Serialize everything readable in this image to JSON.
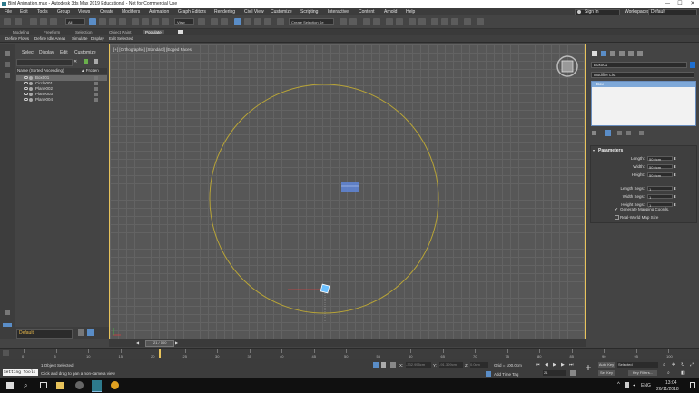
{
  "window": {
    "title": "Bird Animation.max - Autodesk 3ds Max 2019 Educational - Not for Commercial Use",
    "minimize": "—",
    "maximize": "☐",
    "close": "✕"
  },
  "menu": {
    "items": [
      "File",
      "Edit",
      "Tools",
      "Group",
      "Views",
      "Create",
      "Modifiers",
      "Animation",
      "Graph Editors",
      "Rendering",
      "Civil View",
      "Customize",
      "Scripting",
      "Interactive",
      "Content",
      "Arnold",
      "Help"
    ],
    "sign_in": "Sign In",
    "workspaces_label": "Workspaces:",
    "workspaces_value": "Default"
  },
  "toolbar": {
    "filter_value": "All",
    "view_value": "View",
    "selection_set_placeholder": "Create Selection Se",
    "snap_label": "3",
    "angle_label": "%"
  },
  "ribbon": {
    "tabs": [
      "Modeling",
      "Freeform",
      "Selection",
      "Object Paint",
      "Populate"
    ],
    "active_tab": "Populate",
    "subtabs": [
      "Define Flows",
      "Define Idle Areas",
      "Simulate",
      "Display",
      "Edit Selected"
    ]
  },
  "explorer": {
    "tabs": [
      "Select",
      "Display",
      "Edit",
      "Customize"
    ],
    "column_name": "Name (Sorted Ascending)",
    "column_frozen": "▲ Frozen",
    "rows": [
      {
        "name": "Box001",
        "selected": true
      },
      {
        "name": "Circle001",
        "selected": false
      },
      {
        "name": "Plane002",
        "selected": false
      },
      {
        "name": "Plane003",
        "selected": false
      },
      {
        "name": "Plane004",
        "selected": false
      }
    ]
  },
  "viewport": {
    "label": "[+] [Orthographic] [Standard] [Edged Faces]"
  },
  "command_panel": {
    "object_name": "Box001",
    "modifier_list": "Modifier List",
    "stack_item": "Box",
    "rollout_title": "Parameters",
    "params": [
      {
        "label": "Length:",
        "value": "50.0cm"
      },
      {
        "label": "Width:",
        "value": "50.0cm"
      },
      {
        "label": "Height:",
        "value": "50.0cm"
      },
      {
        "label": "Length Segs:",
        "value": "1"
      },
      {
        "label": "Width Segs:",
        "value": "1"
      },
      {
        "label": "Height Segs:",
        "value": "1"
      }
    ],
    "gen_mapping": "Generate Mapping Coords.",
    "real_world": "Real-World Map Size"
  },
  "layer": {
    "name": "Default"
  },
  "time": {
    "slider_label": "21 / 100",
    "ticks": [
      "0",
      "5",
      "10",
      "15",
      "20",
      "25",
      "30",
      "35",
      "40",
      "45",
      "50",
      "55",
      "60",
      "65",
      "70",
      "75",
      "80",
      "85",
      "90",
      "95",
      "100"
    ]
  },
  "status": {
    "script_label": "Setting Tools",
    "objects_selected": "1 Object Selected",
    "hint": "Click and drag to pan a non-camera view",
    "x_label": "X:",
    "x_value": "-332.955cm",
    "y_label": "Y:",
    "y_value": "-91.309cm",
    "z_label": "Z:",
    "z_value": "0.0cm",
    "grid": "Grid = 100.0cm",
    "add_time_tag": "Add Time Tag",
    "frame_value": "21",
    "auto_key": "Auto Key",
    "set_key": "Set Key",
    "selected_dropdown": "Selected",
    "key_filters": "Key Filters..."
  },
  "taskbar": {
    "time": "13:04",
    "date": "26/11/2018",
    "lang": "ENG"
  }
}
